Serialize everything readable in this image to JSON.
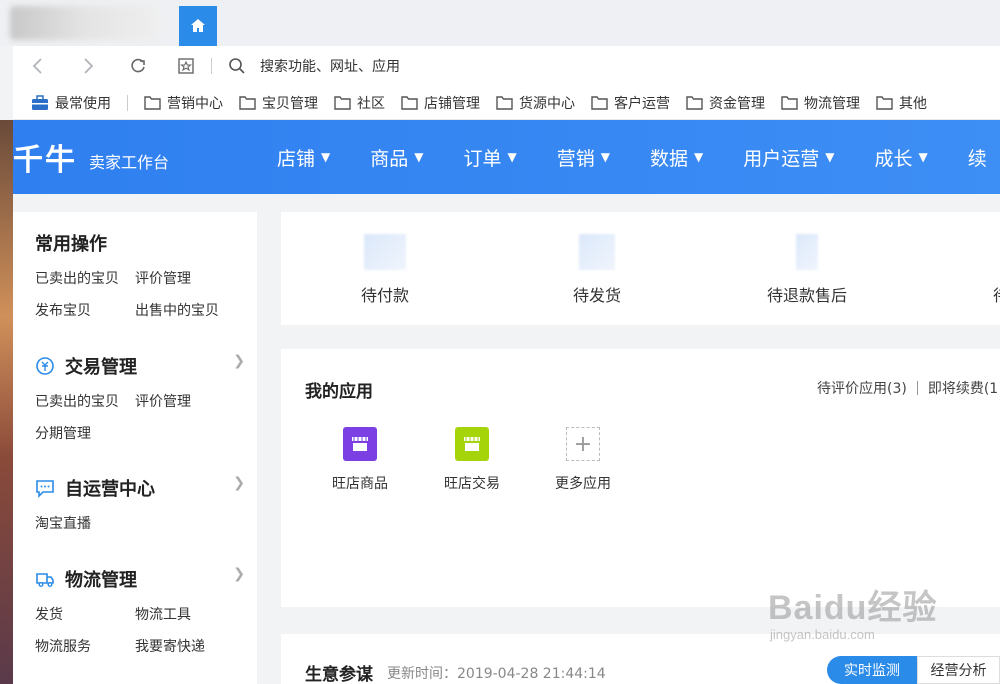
{
  "browser": {
    "address_text": "搜索功能、网址、应用",
    "bookmarks": [
      {
        "label": "最常使用",
        "icon": "toolbox-icon"
      },
      {
        "label": "营销中心",
        "icon": "folder-icon"
      },
      {
        "label": "宝贝管理",
        "icon": "folder-icon"
      },
      {
        "label": "社区",
        "icon": "folder-icon"
      },
      {
        "label": "店铺管理",
        "icon": "folder-icon"
      },
      {
        "label": "货源中心",
        "icon": "folder-icon"
      },
      {
        "label": "客户运营",
        "icon": "folder-icon"
      },
      {
        "label": "资金管理",
        "icon": "folder-icon"
      },
      {
        "label": "物流管理",
        "icon": "folder-icon"
      },
      {
        "label": "其他",
        "icon": "folder-icon"
      }
    ]
  },
  "header": {
    "logo": "千牛",
    "subtitle": "卖家工作台",
    "menu": [
      "店铺",
      "商品",
      "订单",
      "营销",
      "数据",
      "用户运营",
      "成长",
      "续"
    ]
  },
  "sidebar": {
    "common": {
      "title": "常用操作",
      "links": [
        "已卖出的宝贝",
        "评价管理",
        "发布宝贝",
        "出售中的宝贝"
      ]
    },
    "trade": {
      "title": "交易管理",
      "links": [
        "已卖出的宝贝",
        "评价管理",
        "分期管理"
      ]
    },
    "self_ops": {
      "title": "自运营中心",
      "links": [
        "淘宝直播"
      ]
    },
    "logistics": {
      "title": "物流管理",
      "links": [
        "发货",
        "物流工具",
        "物流服务",
        "我要寄快递"
      ]
    }
  },
  "pending": [
    "待付款",
    "待发货",
    "待退款售后",
    "待"
  ],
  "apps": {
    "title": "我的应用",
    "pending_review": "待评价应用(3)",
    "renew": "即将续费(1",
    "items": [
      {
        "label": "旺店商品",
        "color": "#7b3fe4"
      },
      {
        "label": "旺店交易",
        "color": "#a6d40a"
      },
      {
        "label": "更多应用"
      }
    ]
  },
  "bottom": {
    "title": "生意参谋",
    "update_time": "更新时间：2019-04-28 21:44:14",
    "btn_realtime": "实时监测",
    "btn_analysis": "经营分析"
  },
  "watermark": {
    "main": "Baidu经验",
    "sub": "jingyan.baidu.com"
  }
}
